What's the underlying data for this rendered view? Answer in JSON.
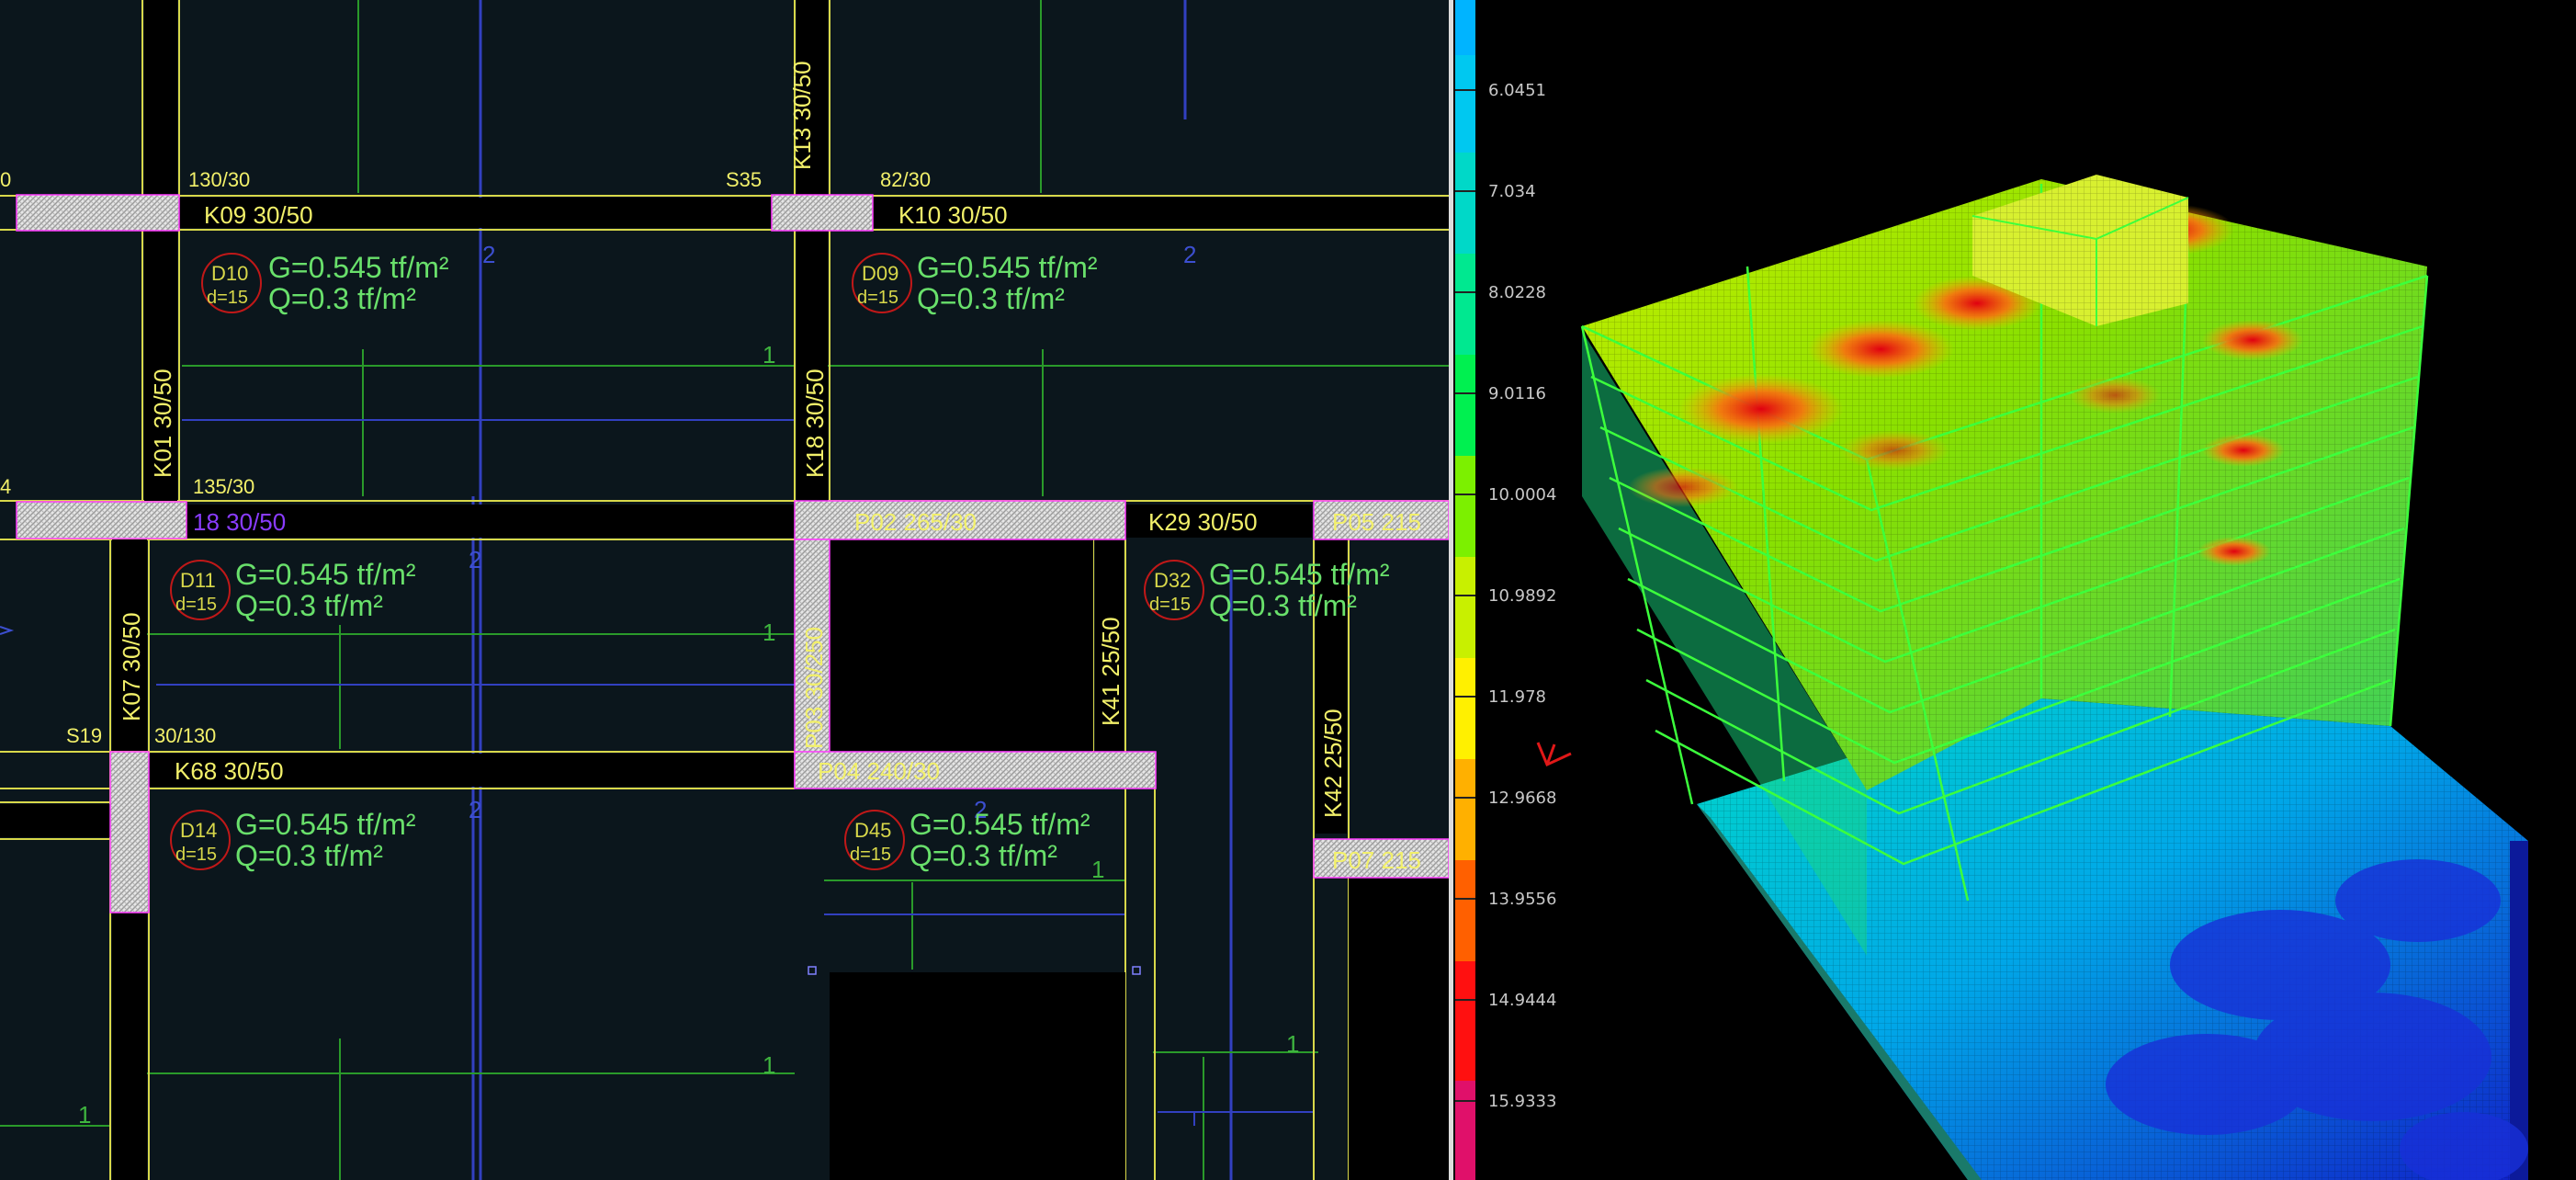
{
  "plan": {
    "beams": {
      "k09": "K09   30/50",
      "k10": "K10   30/50",
      "k18": "18   30/50",
      "k29": "K29  30/50",
      "k68": "K68   30/50",
      "k13": "K13   30/50",
      "k01": "K01   30/50",
      "k18v": "K18   30/50",
      "k07": "K07  30/50",
      "k41": "K41  25/50",
      "k42": "K42  25/50"
    },
    "columns": {
      "s35": "S35",
      "s19": "S19",
      "c130": "130/30",
      "c82": "82/30",
      "c135": "135/30",
      "c30_130": "30/130",
      "left0": "0",
      "left4": "4"
    },
    "walls": {
      "p02": "P02   265/30",
      "p05": "P05   215",
      "p03": "P03   30/250",
      "p04": "P04   240/30",
      "p07": "P07   215"
    },
    "slabs": [
      {
        "id": "D10",
        "d": "d=15",
        "g": "G=0.545 tf/m²",
        "q": "Q=0.3 tf/m²"
      },
      {
        "id": "D09",
        "d": "d=15",
        "g": "G=0.545 tf/m²",
        "q": "Q=0.3 tf/m²"
      },
      {
        "id": "D11",
        "d": "d=15",
        "g": "G=0.545 tf/m²",
        "q": "Q=0.3 tf/m²"
      },
      {
        "id": "D32",
        "d": "d=15",
        "g": "G=0.545 tf/m²",
        "q": "Q=0.3 tf/m²"
      },
      {
        "id": "D14",
        "d": "d=15",
        "g": "G=0.545 tf/m²",
        "q": "Q=0.3 tf/m²"
      },
      {
        "id": "D45",
        "d": "d=15",
        "g": "G=0.545 tf/m²",
        "q": "Q=0.3 tf/m²"
      }
    ],
    "axis_numbers": {
      "two": "2",
      "one": "1"
    }
  },
  "legend": {
    "ticks": [
      "6.0451",
      "7.034",
      "8.0228",
      "9.0116",
      "10.0004",
      "10.9892",
      "11.978",
      "12.9668",
      "13.9556",
      "14.9444",
      "15.9333"
    ],
    "colors": [
      "#00b4ff",
      "#00c8f0",
      "#00d8c8",
      "#00e890",
      "#00f050",
      "#7cf000",
      "#c8f000",
      "#fff000",
      "#ffb000",
      "#ff6000",
      "#ff1010",
      "#e0106a"
    ]
  },
  "colors": {
    "plan_bg": "#0b161c",
    "beam_outline": "#d8d84a",
    "slab_load_text": "#69e06b",
    "grid_blue": "#3c4fd0",
    "grid_green": "#3fb53f",
    "wall_outline": "#ff3cff"
  }
}
